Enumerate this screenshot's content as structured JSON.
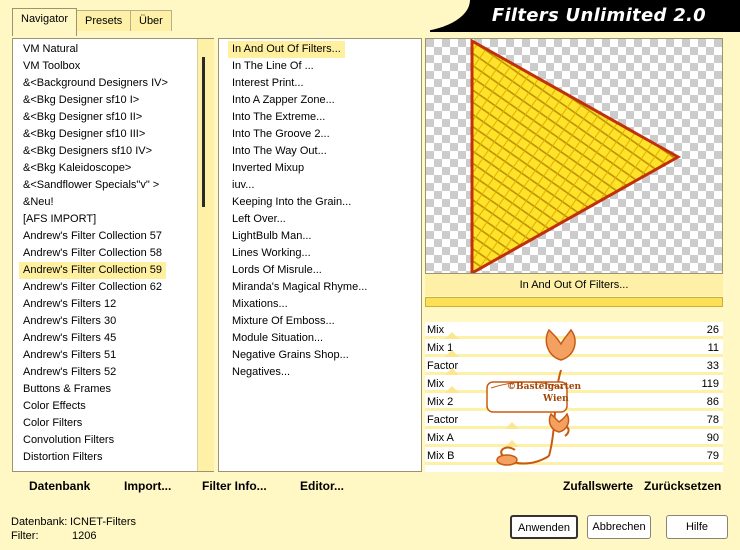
{
  "tabs": [
    "Navigator",
    "Presets",
    "Über"
  ],
  "app_title": "Filters Unlimited 2.0",
  "categories": [
    "VM Natural",
    "VM Toolbox",
    "&<Background Designers IV>",
    "&<Bkg Designer sf10 I>",
    "&<Bkg Designer sf10 II>",
    "&<Bkg Designer sf10 III>",
    "&<Bkg Designers sf10 IV>",
    "&<Bkg Kaleidoscope>",
    "&<Sandflower Specials\"v\" >",
    "&Neu!",
    "[AFS IMPORT]",
    "Andrew's Filter Collection 57",
    "Andrew's Filter Collection 58",
    "Andrew's Filter Collection 59",
    "Andrew's Filter Collection 62",
    "Andrew's Filters 12",
    "Andrew's Filters 30",
    "Andrew's Filters 45",
    "Andrew's Filters 51",
    "Andrew's Filters 52",
    "Buttons & Frames",
    "Color Effects",
    "Color Filters",
    "Convolution Filters",
    "Distortion Filters"
  ],
  "filters": [
    "In And Out Of Filters...",
    "In The Line Of ...",
    "Interest Print...",
    "Into A Zapper Zone...",
    "Into The Extreme...",
    "Into The Groove 2...",
    "Into The Way Out...",
    "Inverted Mixup",
    "iuv...",
    "Keeping Into the Grain...",
    "Left Over...",
    "LightBulb Man...",
    "Lines Working...",
    "Lords Of Misrule...",
    "Miranda's Magical Rhyme...",
    "Mixations...",
    "Mixture Of Emboss...",
    "Module Situation...",
    "Negative Grains Shop...",
    "Negatives..."
  ],
  "selected_filter_name": "In And Out Of Filters...",
  "params": [
    {
      "label": "Mix",
      "value": "26"
    },
    {
      "label": "Mix 1",
      "value": "11"
    },
    {
      "label": "Factor",
      "value": "33"
    },
    {
      "label": "Mix",
      "value": "119"
    },
    {
      "label": "Mix 2",
      "value": "86"
    },
    {
      "label": "Factor",
      "value": "78"
    },
    {
      "label": "Mix A",
      "value": "90"
    },
    {
      "label": "Mix B",
      "value": "79"
    }
  ],
  "watermark": {
    "line1": "©Bastelgarten",
    "line2": "Wien"
  },
  "links": {
    "datenbank": "Datenbank",
    "import": "Import...",
    "filter_info": "Filter Info...",
    "editor": "Editor...",
    "zufall": "Zufallswerte",
    "zurueck": "Zurücksetzen"
  },
  "status": {
    "db_label": "Datenbank:",
    "db_value": "ICNET-Filters",
    "filter_label": "Filter:",
    "filter_value": "1206"
  },
  "buttons": {
    "apply": "Anwenden",
    "cancel": "Abbrechen",
    "help": "Hilfe"
  },
  "colors": {
    "accent": "#fde056",
    "triangle": "#ffe22a",
    "edge": "#c0300a"
  }
}
